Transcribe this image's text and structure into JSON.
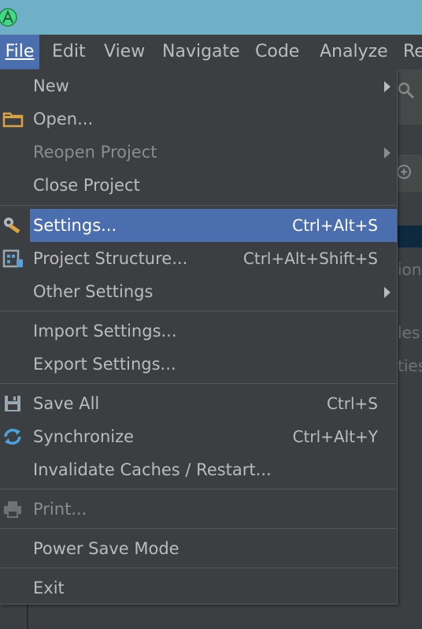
{
  "menubar": {
    "items": [
      {
        "label": "File"
      },
      {
        "label": "Edit"
      },
      {
        "label": "View"
      },
      {
        "label": "Navigate"
      },
      {
        "label": "Code"
      },
      {
        "label": "Analyze"
      },
      {
        "label": "Re"
      }
    ]
  },
  "background": {
    "snippet_1": "ion",
    "snippet_2": "les",
    "snippet_3": "ties"
  },
  "file_menu": {
    "new": {
      "label": "New"
    },
    "open": {
      "label": "Open...",
      "icon": "folder-icon"
    },
    "reopen_project": {
      "label": "Reopen Project"
    },
    "close_project": {
      "label": "Close Project"
    },
    "settings": {
      "label": "Settings...",
      "shortcut": "Ctrl+Alt+S",
      "icon": "wrench-icon"
    },
    "project_structure": {
      "label": "Project Structure...",
      "shortcut": "Ctrl+Alt+Shift+S",
      "icon": "project-structure-icon"
    },
    "other_settings": {
      "label": "Other Settings"
    },
    "import_settings": {
      "label": "Import Settings..."
    },
    "export_settings": {
      "label": "Export Settings..."
    },
    "save_all": {
      "label": "Save All",
      "shortcut": "Ctrl+S",
      "icon": "save-icon"
    },
    "synchronize": {
      "label": "Synchronize",
      "shortcut": "Ctrl+Alt+Y",
      "icon": "sync-icon"
    },
    "invalidate_caches": {
      "label": "Invalidate Caches / Restart..."
    },
    "print": {
      "label": "Print...",
      "icon": "printer-icon"
    },
    "power_save_mode": {
      "label": "Power Save Mode"
    },
    "exit": {
      "label": "Exit"
    }
  },
  "colors": {
    "titlebar": "#6fb0c7",
    "background": "#3c3f41",
    "highlight": "#4b6eaf",
    "text": "#bbbbbb",
    "disabled_text": "#8a8c8e"
  }
}
